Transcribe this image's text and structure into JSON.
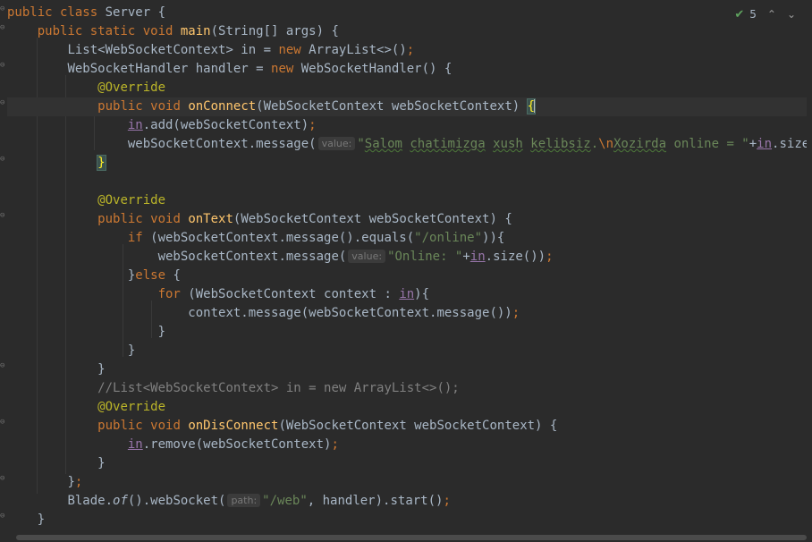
{
  "inspections": {
    "warning_count": "5",
    "prev_label": "^",
    "next_label": "v"
  },
  "code": {
    "l1_kw": "public class ",
    "l1_name": "Server",
    "l1_rest": " {",
    "l2_kw": "public static void ",
    "l2_fn": "main",
    "l2_rest": "(String[] args) {",
    "l3_a": "List<WebSocketContext> in = ",
    "l3_kw": "new",
    "l3_b": " ArrayList<>()",
    "l3_semi": ";",
    "l4_a": "WebSocketHandler handler = ",
    "l4_kw": "new",
    "l4_b": " WebSocketHandler() {",
    "l5_ann": "@Override",
    "l6_kw": "public void ",
    "l6_fn": "onConnect",
    "l6_rest": "(WebSocketContext webSocketContext) ",
    "l6_brace": "{",
    "l7_field": "in",
    "l7_rest": ".add(webSocketContext)",
    "l7_semi": ";",
    "l8_a": "webSocketContext.message(",
    "l8_hint": "value:",
    "l8_q": "\"",
    "l8_w1": "Salom",
    "l8_sp1": " ",
    "l8_w2": "chatimizga",
    "l8_sp2": " ",
    "l8_w3": "xush",
    "l8_sp3": " ",
    "l8_w4": "kelibsiz",
    "l8_dot": ".",
    "l8_esc": "\\n",
    "l8_w5": "Xozirda",
    "l8_s2": " online = \"",
    "l8_plus": "+",
    "l8_field": "in",
    "l8_end": ".size());",
    "l9_brace": "}",
    "l11_ann": "@Override",
    "l12_kw": "public void ",
    "l12_fn": "onText",
    "l12_rest": "(WebSocketContext webSocketContext) {",
    "l13_kw": "if ",
    "l13_a": "(webSocketContext.message().equals(",
    "l13_str": "\"/online\"",
    "l13_b": ")){",
    "l14_a": "webSocketContext.message(",
    "l14_hint": "value:",
    "l14_str": "\"Online: \"",
    "l14_plus": "+",
    "l14_field": "in",
    "l14_end": ".size())",
    "l14_semi": ";",
    "l15_a": "}",
    "l15_kw": "else",
    "l15_b": " {",
    "l16_kw": "for ",
    "l16_a": "(WebSocketContext context : ",
    "l16_field": "in",
    "l16_b": "){",
    "l17_a": "context.message(webSocketContext.message())",
    "l17_semi": ";",
    "l18": "}",
    "l19": "}",
    "l20": "}",
    "l21_cmt": "//List<WebSocketContext> in = new ArrayList<>();",
    "l22_ann": "@Override",
    "l23_kw": "public void ",
    "l23_fn": "onDisConnect",
    "l23_rest": "(WebSocketContext webSocketContext) {",
    "l24_field": "in",
    "l24_rest": ".remove(webSocketContext)",
    "l24_semi": ";",
    "l25": "}",
    "l26_a": "}",
    "l26_semi": ";",
    "l27_a": "Blade.",
    "l27_it": "of",
    "l27_b": "().webSocket(",
    "l27_hint": "path:",
    "l27_str": "\"/web\"",
    "l27_c": ", handler).start()",
    "l27_semi": ";",
    "l28": "}"
  }
}
